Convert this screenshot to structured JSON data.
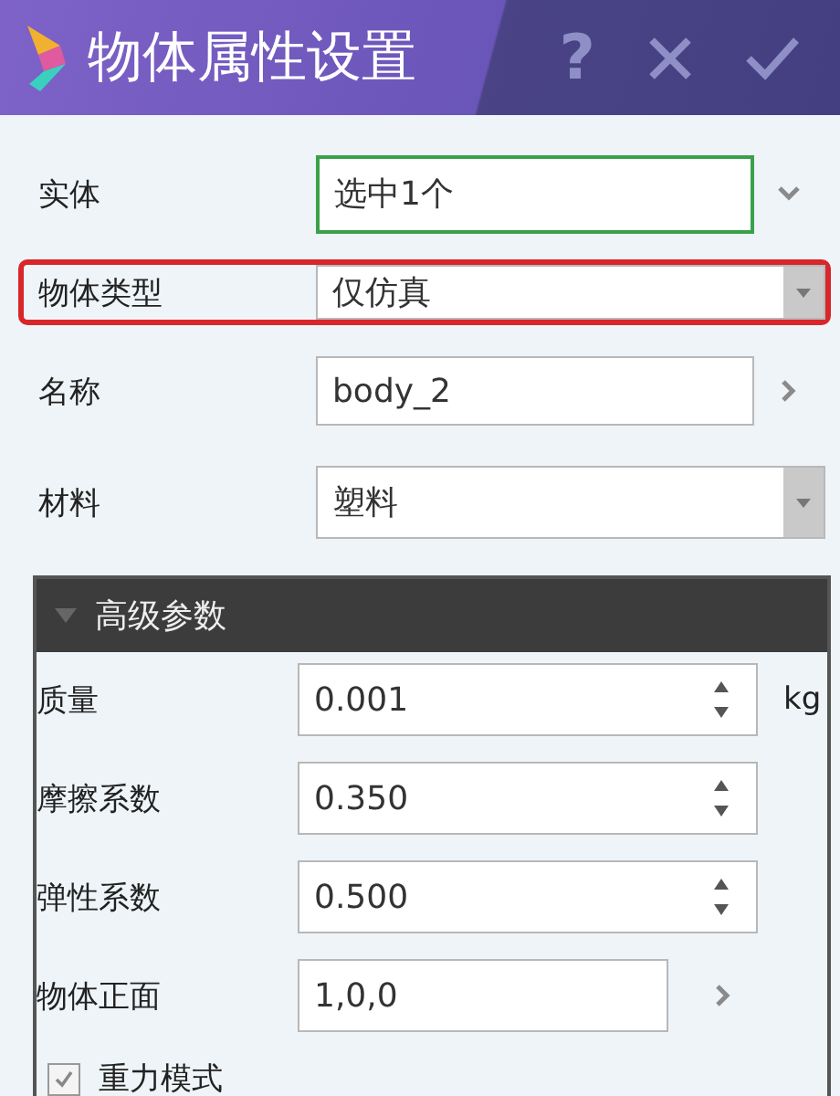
{
  "window": {
    "title": "物体属性设置",
    "help": "?"
  },
  "rows": [
    {
      "label": "实体",
      "value": "选中1个",
      "kind": "text",
      "focused": true,
      "highlighted": false,
      "trailing": {
        "kind": "expand"
      }
    },
    {
      "label": "物体类型",
      "value": "仅仿真",
      "kind": "select",
      "focused": false,
      "highlighted": true
    },
    {
      "label": "名称",
      "value": "body_2",
      "kind": "text",
      "focused": false,
      "highlighted": false,
      "trailing": {
        "kind": "next"
      }
    },
    {
      "label": "材料",
      "value": "塑料",
      "kind": "select",
      "focused": false,
      "highlighted": false
    }
  ],
  "advanced": {
    "title": "高级参数",
    "expanded": true,
    "rows": [
      {
        "label": "质量",
        "value": "0.001",
        "kind": "spin",
        "unit": "kg"
      },
      {
        "label": "摩擦系数",
        "value": "0.350",
        "kind": "spin"
      },
      {
        "label": "弹性系数",
        "value": "0.500",
        "kind": "spin"
      },
      {
        "label": "物体正面",
        "value": "1,0,0",
        "kind": "text",
        "trailing": {
          "kind": "next"
        }
      }
    ],
    "checkbox": {
      "label": "重力模式",
      "checked": true
    }
  }
}
